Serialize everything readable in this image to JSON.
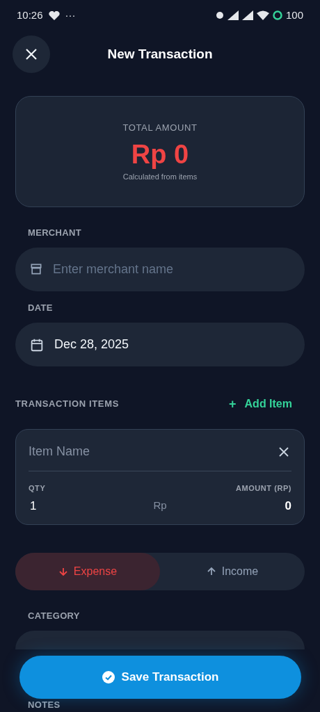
{
  "status_bar": {
    "time": "10:26",
    "more": "···",
    "battery": "100"
  },
  "header": {
    "title": "New Transaction"
  },
  "total": {
    "label": "TOTAL AMOUNT",
    "amount": "Rp 0",
    "note": "Calculated from items"
  },
  "merchant": {
    "label": "MERCHANT",
    "placeholder": "Enter merchant name"
  },
  "date": {
    "label": "DATE",
    "value": "Dec 28, 2025"
  },
  "items_section": {
    "label": "TRANSACTION ITEMS",
    "add_button": "+",
    "add_label": "Add Item"
  },
  "items": [
    {
      "name_placeholder": "Item Name",
      "qty_label": "QTY",
      "qty": "1",
      "currency": "Rp",
      "amount_label": "AMOUNT (RP)",
      "amount": "0"
    }
  ],
  "type_toggle": [
    {
      "kind": "expense",
      "label": "Expense",
      "selected": true
    },
    {
      "kind": "income",
      "label": "Income",
      "selected": false
    }
  ],
  "category": {
    "label": "CATEGORY"
  },
  "notes": {
    "label": "NOTES"
  },
  "save_button": "Save Transaction"
}
